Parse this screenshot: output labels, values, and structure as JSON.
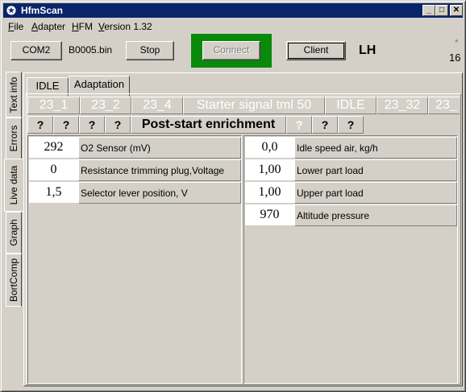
{
  "app": {
    "title": "HfmScan",
    "logo_icon": "mercedes-star-icon"
  },
  "caption_buttons": {
    "minimize": "_",
    "maximize": "□",
    "close": "✕"
  },
  "menu": [
    {
      "accel": "F",
      "rest": "ile"
    },
    {
      "accel": "A",
      "rest": "dapter"
    },
    {
      "accel": "H",
      "rest": "FM"
    },
    {
      "accel": "V",
      "rest": "ersion 1.32"
    }
  ],
  "toolbar": {
    "com_button": "COM2",
    "file_name": "B0005.bin",
    "stop_button": "Stop",
    "connect_button": "Connect",
    "client_button": "Client",
    "mode_label": "LH",
    "asterisk": "*",
    "counter": "16",
    "connect_frame_color": "#0a8a0a"
  },
  "side_tabs": [
    "Text info",
    "Errors",
    "Live data",
    "Graph",
    "BortComp"
  ],
  "active_side_tab": "Live data",
  "top_tabs": [
    "IDLE",
    "Adaptation"
  ],
  "active_top_tab": "Adaptation",
  "channel_headers": [
    "23_1",
    "23_2",
    "23_4",
    "Starter signal tml 50",
    "IDLE",
    "23_32",
    "23_"
  ],
  "status_row": [
    "?",
    "?",
    "?",
    "?",
    "Post-start enrichment",
    "?",
    "?",
    "?"
  ],
  "left_rows": [
    {
      "value": "292",
      "label": "O2 Sensor (mV)"
    },
    {
      "value": "0",
      "label": "Resistance trimming plug,Voltage"
    },
    {
      "value": "1,5",
      "label": "Selector lever position, V"
    }
  ],
  "right_rows": [
    {
      "value": "0,0",
      "label": "Idle speed air, kg/h"
    },
    {
      "value": "1,00",
      "label": "Lower part load"
    },
    {
      "value": "1,00",
      "label": "Upper part load"
    },
    {
      "value": "970",
      "label": "Altitude pressure"
    }
  ]
}
